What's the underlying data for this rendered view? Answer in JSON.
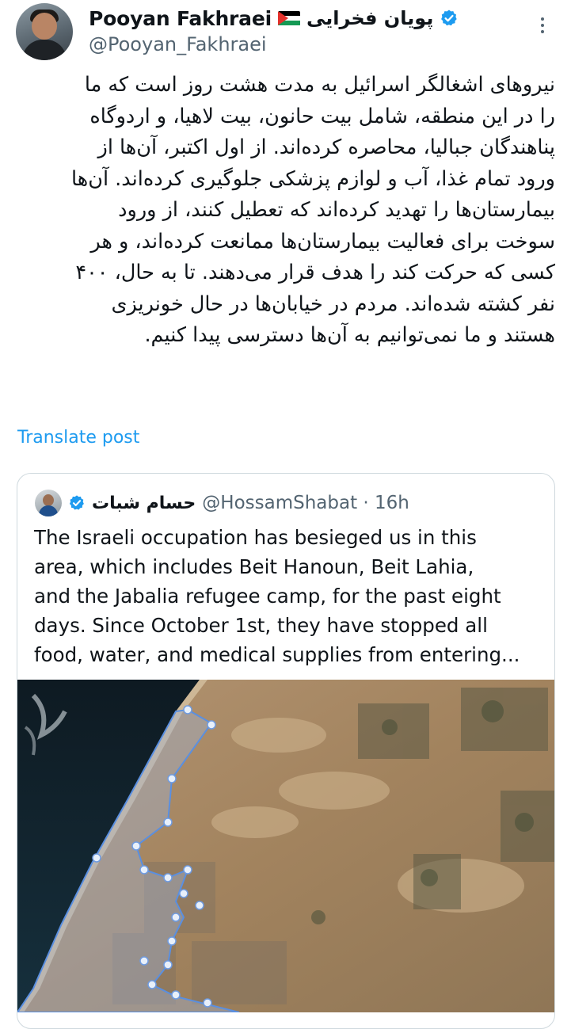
{
  "author": {
    "display_name": "Pooyan Fakhraei",
    "persian_name": "پویان فخرایی",
    "handle": "@Pooyan_Fakhraei"
  },
  "post": {
    "lines": [
      "نیروهای اشغالگر اسرائیل به مدت هشت روز است که ما",
      "را در این منطقه، شامل بیت حانون، بیت لاهیا، و اردوگاه",
      "پناهندگان جبالیا، محاصره کرده‌اند. از اول اکتبر، آن‌ها از",
      "ورود تمام غذا، آب و لوازم پزشکی جلوگیری کرده‌اند. آن‌ها",
      "بیمارستان‌ها را تهدید کرده‌اند که تعطیل کنند، از ورود",
      "سوخت برای فعالیت بیمارستان‌ها ممانعت کرده‌اند، و هر",
      "کسی که حرکت کند را هدف قرار می‌دهند. تا به حال، ۴۰۰",
      "نفر کشته شده‌اند. مردم در خیابان‌ها در حال خونریزی",
      "هستند و ما نمی‌توانیم به آن‌ها دسترسی پیدا کنیم."
    ],
    "translate_label": "Translate post"
  },
  "quote": {
    "name": "حسام شبات",
    "handle_time": "@HossamShabat · 16h",
    "lines": [
      "The Israeli occupation has besieged us in this",
      "area, which includes Beit Hanoun, Beit Lahia,",
      "and the Jabalia refugee camp, for the past eight",
      "days. Since October 1st, they have stopped all",
      "food, water, and medical supplies from entering..."
    ]
  },
  "colors": {
    "accent": "#1d9bf0",
    "secondary_text": "#536471",
    "border": "#cfd9de"
  },
  "icons": [
    "verified-badge-icon",
    "palestine-flag-icon",
    "more-options-icon"
  ]
}
